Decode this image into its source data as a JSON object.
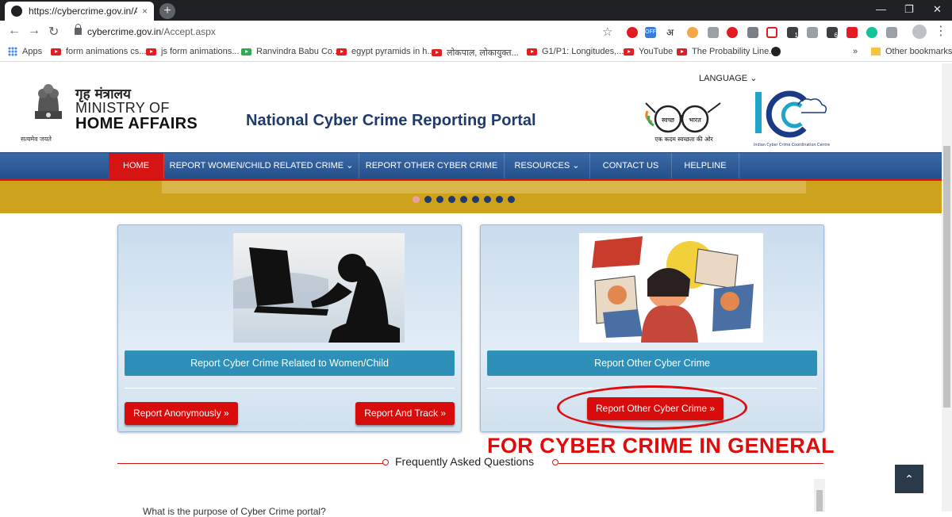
{
  "browser": {
    "tab_title": "https://cybercrime.gov.in/Accept",
    "tab_close": "×",
    "new_tab": "+",
    "url_host": "cybercrime.gov.in",
    "url_path": "/Accept.aspx",
    "back": "←",
    "forward": "→",
    "reload": "↻",
    "star": "☆",
    "menu": "⋮",
    "win_min": "—",
    "win_max": "❐",
    "win_close": "✕",
    "ext_off_badge": "OFF",
    "ext_hindi": "अ",
    "ext_badge_1": "1",
    "ext_badge_6": "6"
  },
  "bookmarks": {
    "apps": "Apps",
    "items": [
      "form animations cs...",
      "js form animations...",
      "Ranvindra Babu Co...",
      "egypt pyramids in h...",
      "लोकपाल, लोकायुक्त...",
      "G1/P1: Longitudes,...",
      "YouTube",
      "The Probability Line..."
    ],
    "more": "»",
    "other": "Other bookmarks"
  },
  "header": {
    "hindi_ministry": "गृह मंत्रालय",
    "ministry_line1": "MINISTRY OF",
    "ministry_line2": "HOME AFFAIRS",
    "emblem_caption": "सत्यमेव जयते",
    "portal_title": "National Cyber Crime Reporting Portal",
    "language": "LANGUAGE",
    "language_caret": "⌄",
    "swachh_left": "स्वच्छ",
    "swachh_right": "भारत",
    "swachh_tagline": "एक कदम स्वच्छता की ओर",
    "i4c_caption": "Indian Cyber Crime Coordination Centre"
  },
  "nav": {
    "items": [
      "HOME",
      "REPORT WOMEN/CHILD RELATED CRIME ⌄",
      "REPORT OTHER CYBER CRIME",
      "RESOURCES ⌄",
      "CONTACT US",
      "HELPLINE"
    ],
    "active_index": 0
  },
  "slider": {
    "dot_count": 9,
    "active_dot": 0
  },
  "cards": {
    "women_child": {
      "bar_label": "Report Cyber Crime Related to Women/Child",
      "btn_anonymous": "Report Anonymously »",
      "btn_track": "Report And Track »"
    },
    "other": {
      "bar_label": "Report Other Cyber Crime",
      "btn_report": "Report Other Cyber Crime »"
    }
  },
  "annotation": {
    "text": "FOR CYBER CRIME IN GENERAL"
  },
  "faq": {
    "title": "Frequently Asked Questions",
    "first_question": "What is the purpose of Cyber Crime portal?"
  },
  "scroll_top": "⌃",
  "colors": {
    "nav_blue": "#2f5d9a",
    "accent_red": "#d61414",
    "card_bar": "#2e8fb8",
    "banner_gold": "#cda21d",
    "title_blue": "#1f3a6d"
  }
}
